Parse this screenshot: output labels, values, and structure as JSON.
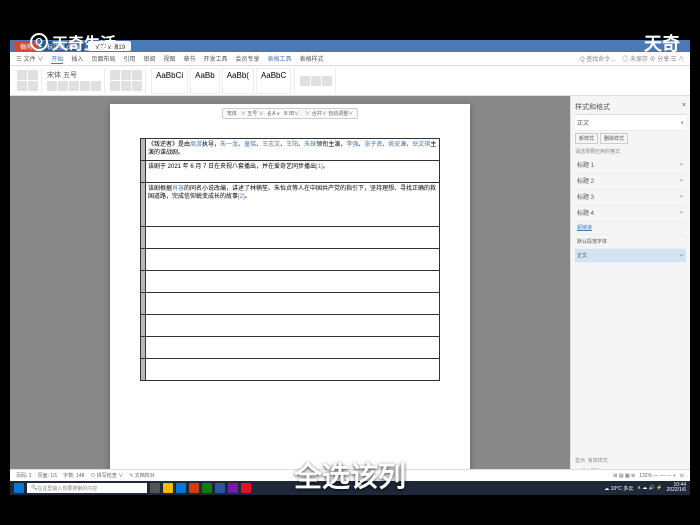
{
  "watermark": {
    "text": "天奇生活",
    "right": "天奇"
  },
  "subtitle": "全选该列",
  "tabs": [
    {
      "label": "稿壳",
      "cls": "red"
    },
    {
      "label": "标注器.docx",
      "cls": "blue"
    },
    {
      "label": "文字文稿19",
      "cls": "active"
    }
  ],
  "menu": [
    "三 文件 ∨",
    "开始",
    "插入",
    "页面布局",
    "引用",
    "审阅",
    "视图",
    "章节",
    "开发工具",
    "会员专享",
    "表格工具",
    "表格样式"
  ],
  "menu_right": [
    "Q 查找命令…",
    "◎ 未保存  ⊕ 分享 ☰ ∧"
  ],
  "ribbon": {
    "font": "宋体",
    "size": "五号",
    "styles": [
      "AaBbCi",
      "AaBb",
      "AaBb(",
      "AaBbC"
    ]
  },
  "float_tb": [
    "宋体",
    "∨ 五号 ∨",
    "A̲ A ∨",
    "B 田∨ ⬚∨ 合并∨ 自动调整∨"
  ],
  "cells": [
    "《叛逆者》是由<link>周游</link>执导，<link>朱一龙</link>、<link>童瑶</link>、<link>王志文</link>、<link>王阳</link>、<link>朱珠</link>领衔主演，<link>李强</link>、<link>张子贤</link>、<link>姚安濂</link>、<link>岳文琪</link>主演的谍战剧。",
    "该剧于 2021 年 6 月 7 日在央视八套播出，并在爱奇艺同步播出<link>[1]</link>。",
    "该剧根据<link>肖容</link>的同名小说改编，讲述了林楠笙、朱怡贞等人在中国共产党的指引下，坚持理想、寻找正确的救国道路，完成信仰蜕变成长的故事<link>[2]</link>。"
  ],
  "styles_panel": {
    "title": "样式和格式",
    "current": "正文",
    "buttons": [
      "新样式",
      "删除样式"
    ],
    "hint": "请选择要应用的格式",
    "items": [
      "标题 1",
      "标题 2",
      "标题 3",
      "标题 4",
      "超链接",
      "默认段落字体",
      "正文"
    ],
    "footer1": "显示: 有效样式",
    "footer2": "☑ 显示预览"
  },
  "status": {
    "left": [
      "页码: 1",
      "页面: 1/1",
      "字数: 148",
      "⊙ 拼写检查 ∨",
      "✎ 文档校对"
    ],
    "right": [
      "⊞ ▤ ▦ ⊕",
      "132% — —·— +",
      "⊙"
    ]
  },
  "taskbar": {
    "search_ph": "在这里输入你要搜索的内容",
    "weather": "☁ 10°C 多云",
    "time": "10:44",
    "date": "2022/1/6"
  }
}
